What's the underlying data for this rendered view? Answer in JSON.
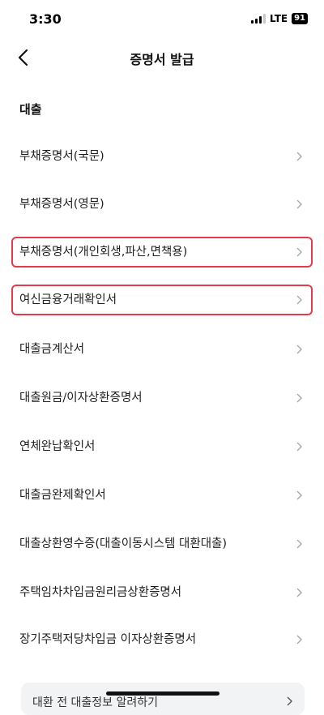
{
  "status": {
    "time": "3:30",
    "network": "LTE",
    "battery": "91"
  },
  "header": {
    "title": "증명서 발급"
  },
  "section": {
    "title": "대출"
  },
  "items": [
    {
      "label": "부채증명서(국문)"
    },
    {
      "label": "부채증명서(영문)"
    },
    {
      "label": "부채증명서(개인회생,파산,면책용)"
    },
    {
      "label": "여신금융거래확인서"
    },
    {
      "label": "대출금계산서"
    },
    {
      "label": "대출원금/이자상환증명서"
    },
    {
      "label": "연체완납확인서"
    },
    {
      "label": "대출금완제확인서"
    },
    {
      "label": "대출상환영수증(대출이동시스템 대환대출)"
    },
    {
      "label": "주택임차차입금원리금상환증명서"
    },
    {
      "label": "장기주택저당차입금 이자상환증명서"
    }
  ],
  "bottom_card": {
    "label": "대환 전 대출정보 알려하기"
  },
  "colors": {
    "highlight": "#e33b4b",
    "card_background": "#f2f3f5",
    "chevron": "#a9a9a9"
  }
}
